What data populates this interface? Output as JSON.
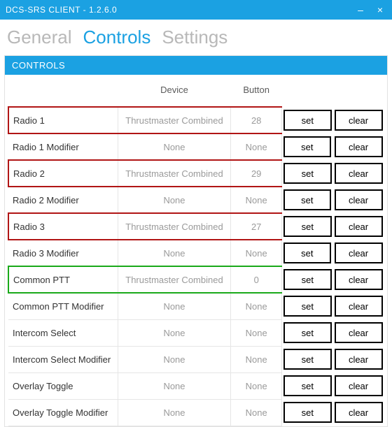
{
  "window": {
    "title": "DCS-SRS CLIENT - 1.2.6.0"
  },
  "tabs": {
    "general": "General",
    "controls": "Controls",
    "settings": "Settings",
    "active": "controls"
  },
  "panel": {
    "header": "CONTROLS",
    "columns": {
      "name": "",
      "device": "Device",
      "button": "Button"
    },
    "buttons": {
      "set": "set",
      "clear": "clear"
    },
    "rows": [
      {
        "name": "Radio 1",
        "device": "Thrustmaster Combined",
        "button": "28",
        "highlight": "red"
      },
      {
        "name": "Radio 1 Modifier",
        "device": "None",
        "button": "None",
        "highlight": ""
      },
      {
        "name": "Radio 2",
        "device": "Thrustmaster Combined",
        "button": "29",
        "highlight": "red"
      },
      {
        "name": "Radio 2 Modifier",
        "device": "None",
        "button": "None",
        "highlight": ""
      },
      {
        "name": "Radio 3",
        "device": "Thrustmaster Combined",
        "button": "27",
        "highlight": "red"
      },
      {
        "name": "Radio 3 Modifier",
        "device": "None",
        "button": "None",
        "highlight": ""
      },
      {
        "name": "Common PTT",
        "device": "Thrustmaster Combined",
        "button": "0",
        "highlight": "green"
      },
      {
        "name": "Common PTT Modifier",
        "device": "None",
        "button": "None",
        "highlight": ""
      },
      {
        "name": "Intercom Select",
        "device": "None",
        "button": "None",
        "highlight": ""
      },
      {
        "name": "Intercom Select Modifier",
        "device": "None",
        "button": "None",
        "highlight": ""
      },
      {
        "name": "Overlay Toggle",
        "device": "None",
        "button": "None",
        "highlight": ""
      },
      {
        "name": "Overlay Toggle Modifier",
        "device": "None",
        "button": "None",
        "highlight": ""
      }
    ]
  }
}
